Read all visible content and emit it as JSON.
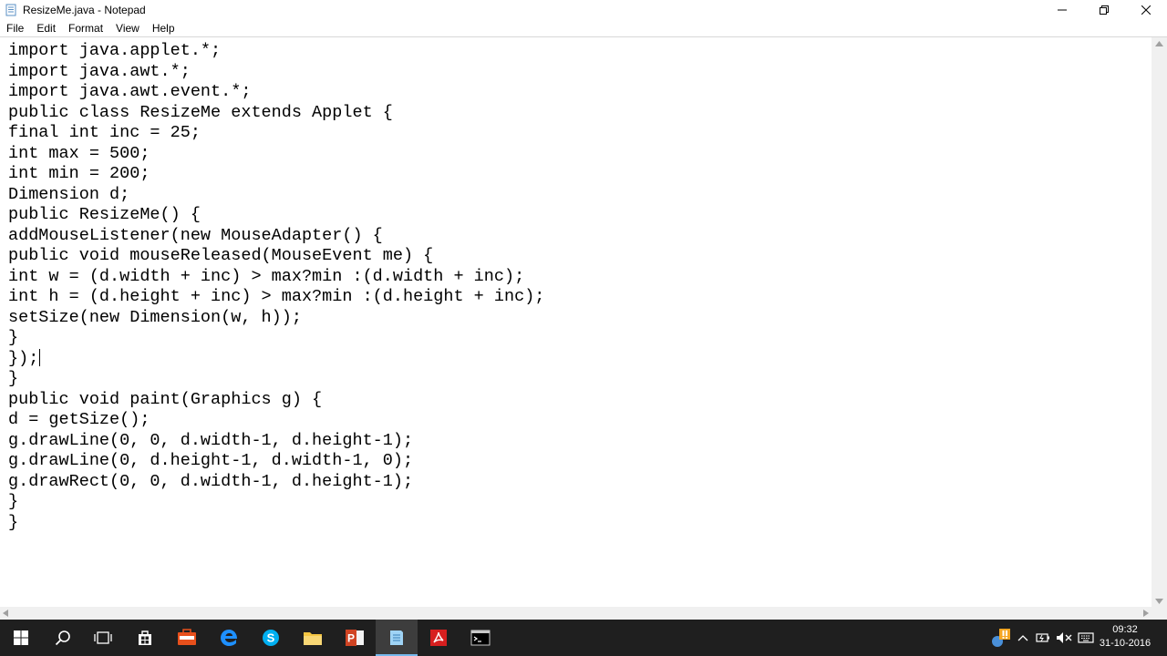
{
  "window": {
    "title": "ResizeMe.java - Notepad",
    "controls": [
      "minimize-icon",
      "restore-icon",
      "close-icon"
    ]
  },
  "menu": {
    "items": [
      {
        "label": "File"
      },
      {
        "label": "Edit"
      },
      {
        "label": "Format"
      },
      {
        "label": "View"
      },
      {
        "label": "Help"
      }
    ]
  },
  "editor": {
    "lines": [
      "import java.applet.*;",
      "import java.awt.*;",
      "import java.awt.event.*;",
      "public class ResizeMe extends Applet {",
      "final int inc = 25;",
      "int max = 500;",
      "int min = 200;",
      "Dimension d;",
      "public ResizeMe() {",
      "addMouseListener(new MouseAdapter() {",
      "public void mouseReleased(MouseEvent me) {",
      "int w = (d.width + inc) > max?min :(d.width + inc);",
      "int h = (d.height + inc) > max?min :(d.height + inc);",
      "setSize(new Dimension(w, h));",
      "}",
      "});",
      "}",
      "public void paint(Graphics g) {",
      "d = getSize();",
      "g.drawLine(0, 0, d.width-1, d.height-1);",
      "g.drawLine(0, d.height-1, d.width-1, 0);",
      "g.drawRect(0, 0, d.width-1, d.height-1);",
      "}",
      "}"
    ]
  },
  "taskbar": {
    "apps": [
      "windows-start-icon",
      "search-icon",
      "task-view-icon",
      "store-icon",
      "toolbox-app-icon",
      "edge-icon",
      "skype-icon",
      "file-explorer-icon",
      "powerpoint-icon",
      "notepad-icon",
      "acrobat-icon",
      "command-prompt-icon"
    ],
    "tray": [
      "notification-badge-icon",
      "show-hidden-icons-chevron",
      "power-icon",
      "volume-muted-icon",
      "keyboard-icon"
    ],
    "time": "09:32",
    "date": "31-10-2016"
  },
  "colors": {
    "taskbar_bg": "#1f1f1f",
    "active_indicator": "#76b9ed"
  }
}
